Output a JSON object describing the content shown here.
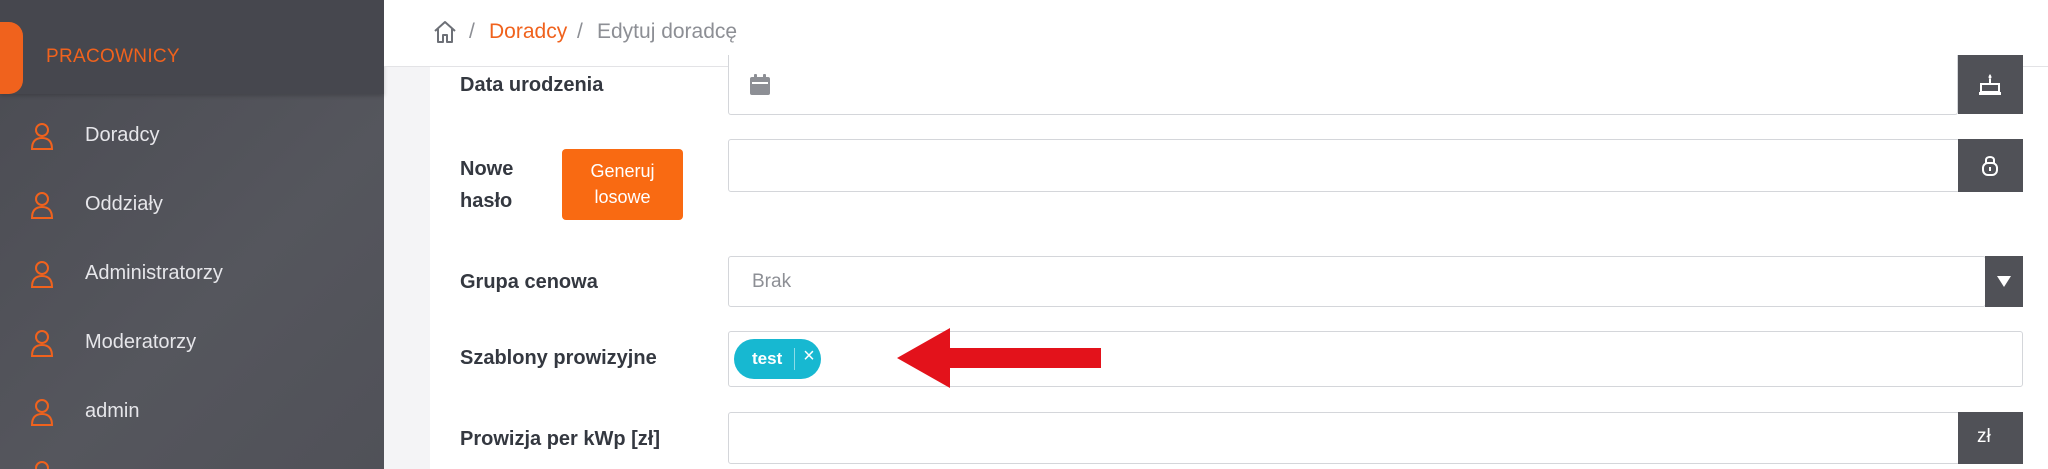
{
  "sidebar": {
    "section_label": "PRACOWNICY",
    "items": [
      {
        "label": "Doradcy",
        "icon": "user-icon"
      },
      {
        "label": "Oddziały",
        "icon": "user-icon"
      },
      {
        "label": "Administratorzy",
        "icon": "user-icon"
      },
      {
        "label": "Moderatorzy",
        "icon": "user-icon"
      },
      {
        "label": "admin",
        "icon": "user-icon"
      }
    ]
  },
  "breadcrumb": {
    "home_icon": "home-icon",
    "separator": "/",
    "link": "Doradcy",
    "current": "Edytuj doradcę"
  },
  "form": {
    "birth_date": {
      "label": "Data urodzenia",
      "value": "",
      "left_icon": "calendar-icon",
      "addon_icon": "cake-icon"
    },
    "password": {
      "label_line1": "Nowe",
      "label_line2": "hasło",
      "button_line1": "Generuj",
      "button_line2": "losowe",
      "value": "",
      "addon_icon": "lock-icon"
    },
    "price_group": {
      "label": "Grupa cenowa",
      "selected": "Brak",
      "addon_icon": "caret-down-icon"
    },
    "commission_templates": {
      "label": "Szablony prowizyjne",
      "tags": [
        "test"
      ],
      "remove_icon": "close-icon"
    },
    "commission_per_kwp": {
      "label": "Prowizja per kWp [zł]",
      "value": "",
      "addon_text": "zł"
    }
  },
  "annotation": {
    "arrow_color": "#e3121b",
    "arrow_icon": "arrow-left-icon"
  },
  "colors": {
    "accent": "#f0621d",
    "sidebar_bg": "#505158",
    "tag_bg": "#17b8d1",
    "addon_bg": "#505157",
    "button_bg": "#f96a12"
  }
}
